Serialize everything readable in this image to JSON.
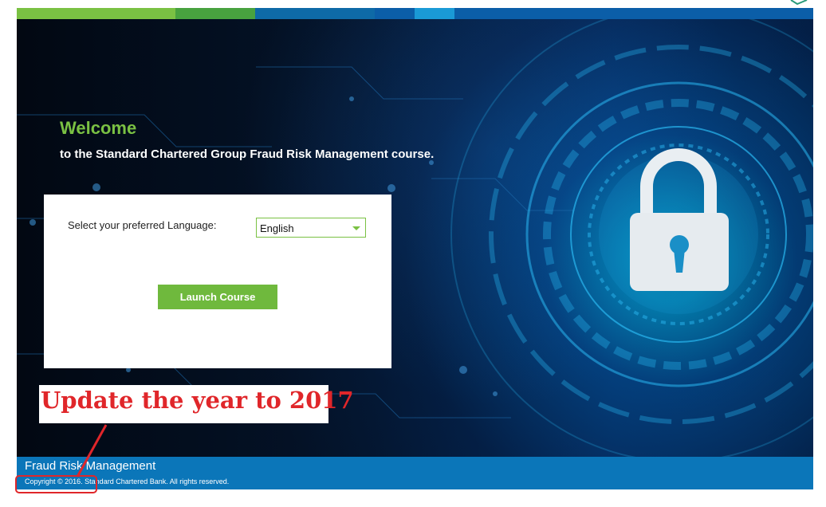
{
  "colors": {
    "topbar": [
      "#7ac143",
      "#48a23f",
      "#0e6aa7",
      "#0b5ea8",
      "#1a9ad6",
      "#0b5ea8"
    ],
    "accent_green": "#7ac143",
    "footer_blue": "#0b76b9",
    "annotation_red": "#e0262a"
  },
  "hero": {
    "welcome": "Welcome",
    "subtitle": "to the Standard Chartered Group Fraud Risk Management course.",
    "icon": "padlock-icon"
  },
  "panel": {
    "language_label": "Select your preferred Language:",
    "language_selected": "English",
    "launch_label": "Launch Course"
  },
  "annotation": {
    "note": "Update the year to 2017"
  },
  "footer": {
    "title": "Fraud Risk Management",
    "copyright": "Copyright © 2016. Standard Chartered Bank. All rights reserved."
  }
}
